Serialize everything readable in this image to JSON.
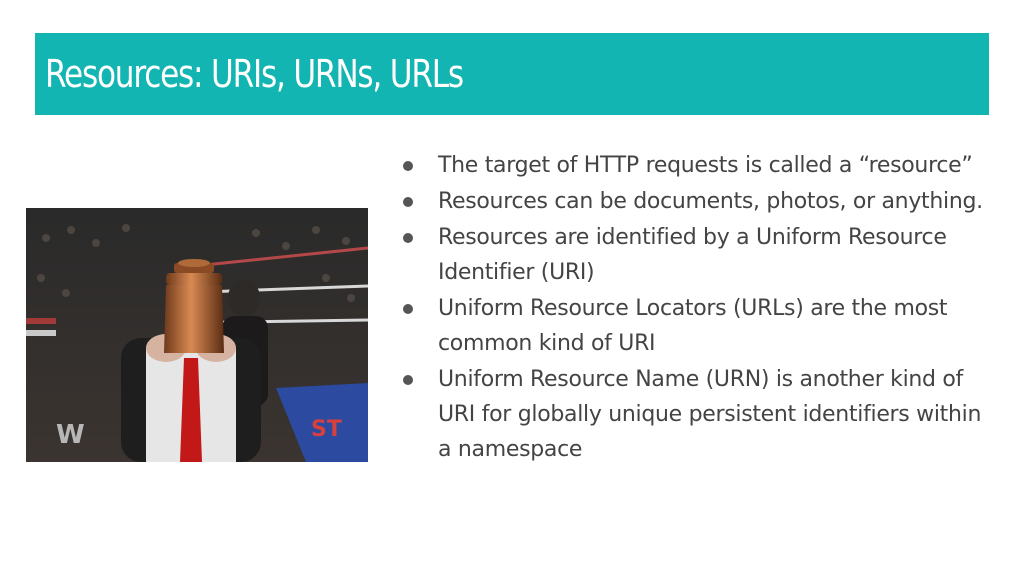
{
  "slide": {
    "title": "Resources: URIs, URNs, URLs",
    "title_bar_color": "#12b5b1",
    "photo_watermark": "W",
    "bullets": [
      {
        "text": "The target of HTTP requests is called a “resource”"
      },
      {
        "text": "Resources can be documents, photos, or anything."
      },
      {
        "text": "Resources are identified by a Uniform Resource Identifier (URI)"
      },
      {
        "text": "Uniform Resource Locators (URLs) are the most common kind of URI"
      },
      {
        "text": "Uniform Resource Name (URN) is another kind of URI for globally unique persistent identifiers within a namespace"
      }
    ]
  }
}
